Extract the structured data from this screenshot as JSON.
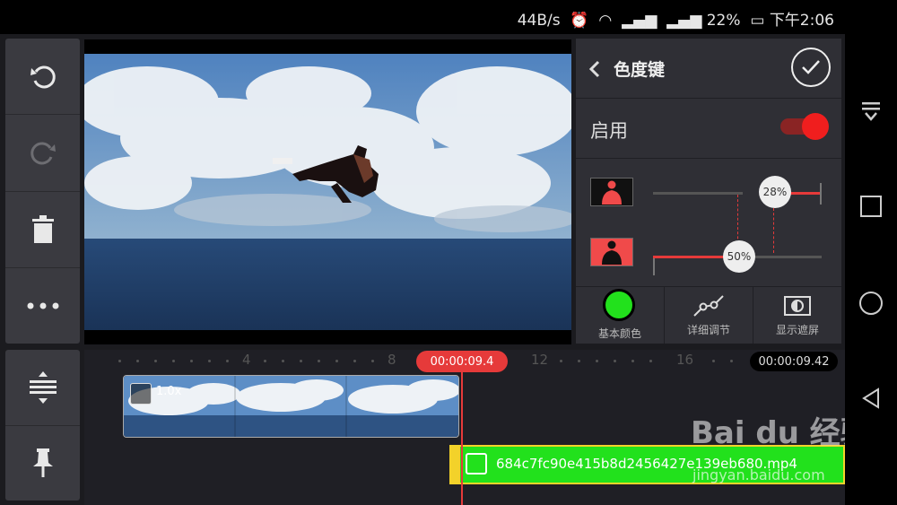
{
  "status_bar": {
    "speed": "44B/s",
    "battery_percent": "22%",
    "time": "下午2:06"
  },
  "panel": {
    "title": "色度键",
    "enable_label": "启用",
    "enabled": true,
    "slider_top_value": "28%",
    "slider_bottom_value": "50%",
    "tabs": [
      {
        "label": "基本颜色",
        "icon": "color-circle-icon"
      },
      {
        "label": "详细调节",
        "icon": "curve-icon"
      },
      {
        "label": "显示遮屏",
        "icon": "contrast-icon"
      }
    ]
  },
  "timeline": {
    "playhead_time": "00:00:09.4",
    "total_time": "00:00:09.42",
    "ruler_labels": [
      "4",
      "8",
      "12",
      "16"
    ],
    "clip1_speed": "1.0x",
    "clip2_name": "684c7fc90e415b8d2456427e139eb680.mp4"
  },
  "colors": {
    "accent_red": "#e63a3a",
    "key_green": "#22e11c",
    "handle_yellow": "#f3d22a"
  },
  "watermark": {
    "brand": "Bai du 经验",
    "url": "jingyan.baidu.com"
  }
}
